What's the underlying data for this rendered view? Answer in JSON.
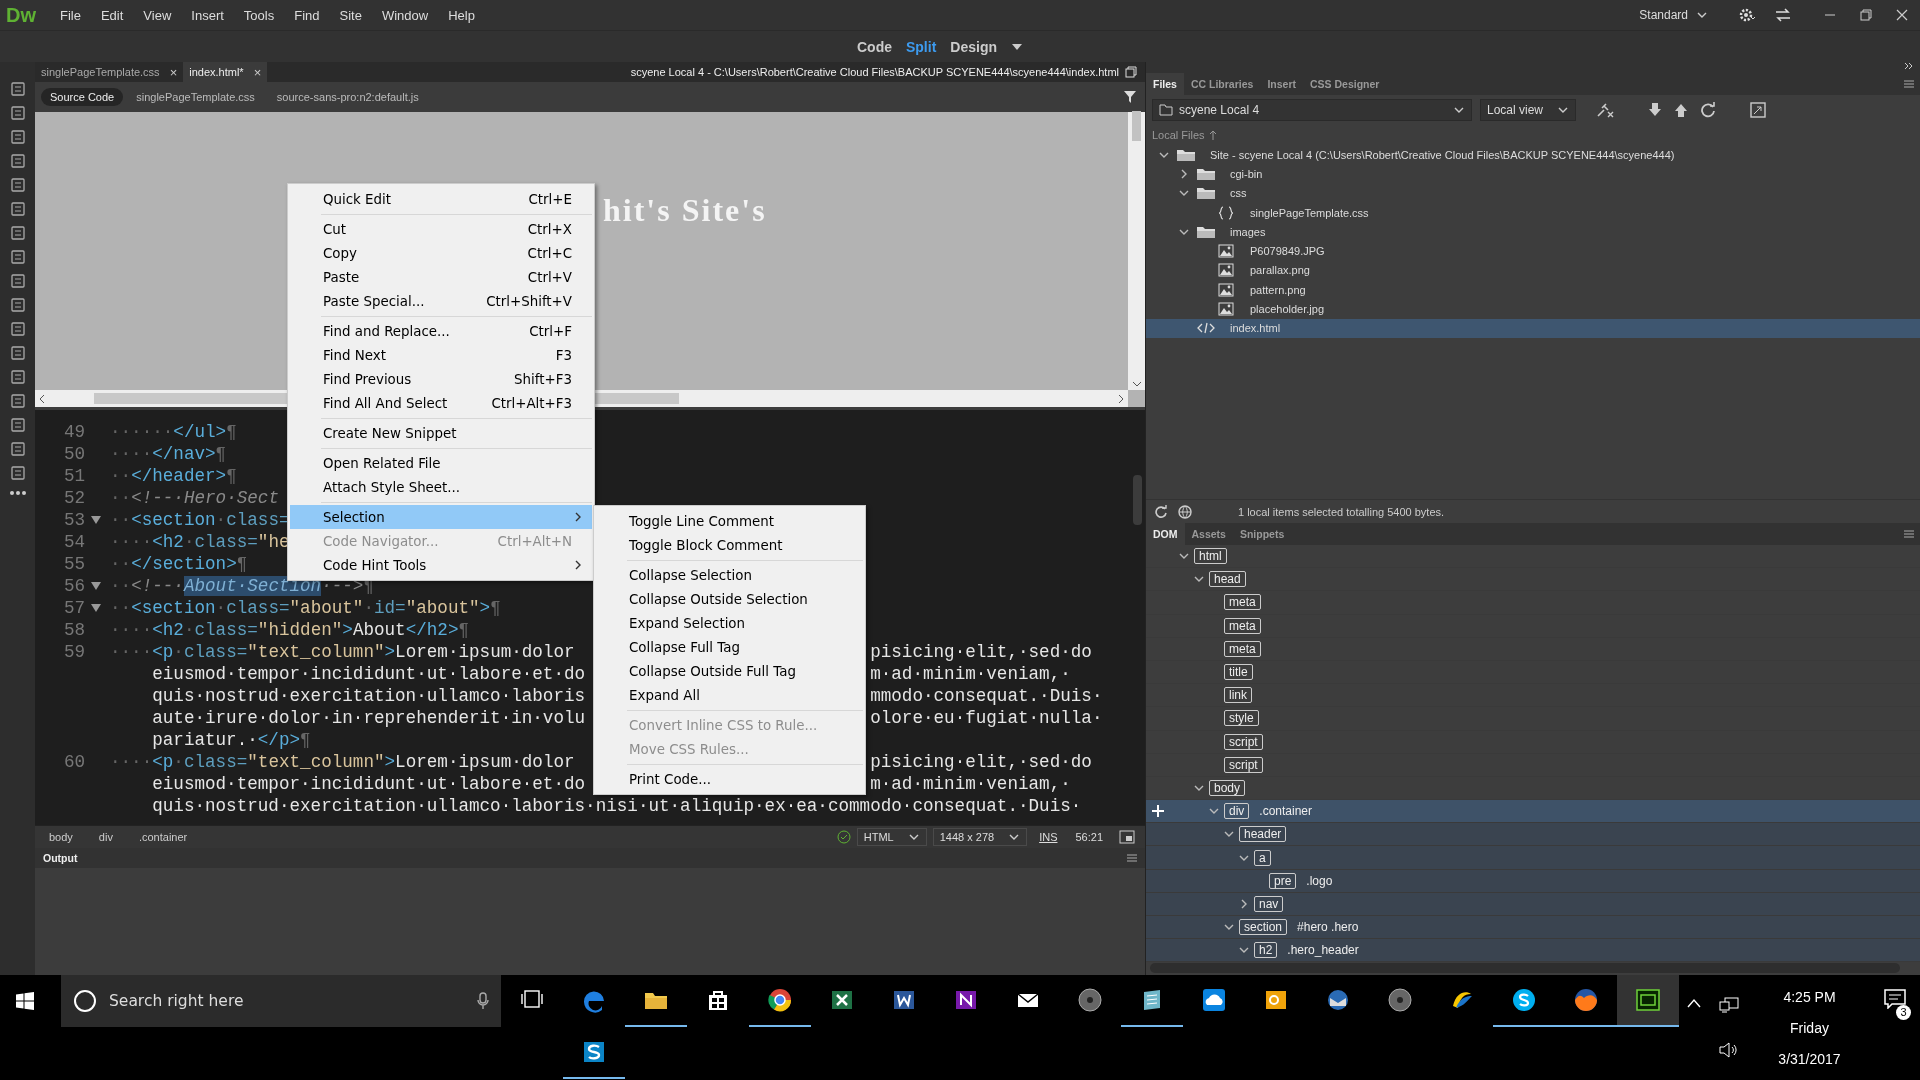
{
  "app": {
    "logo": "Dw",
    "menu": [
      "File",
      "Edit",
      "View",
      "Insert",
      "Tools",
      "Find",
      "Site",
      "Window",
      "Help"
    ],
    "workspace": "Standard"
  },
  "view_switch": [
    {
      "label": "Code",
      "selected": false
    },
    {
      "label": "Split",
      "selected": true
    },
    {
      "label": "Design",
      "selected": false
    }
  ],
  "document_tabs": [
    {
      "label": "singlePageTemplate.css",
      "close": "×",
      "selected": false
    },
    {
      "label": "index.html*",
      "close": "×",
      "selected": true
    }
  ],
  "document_path": "scyene Local 4 - C:\\Users\\Robert\\Creative Cloud Files\\BACKUP SCYENE444\\scyene444\\index.html",
  "related_files": [
    {
      "label": "Source Code",
      "selected": true
    },
    {
      "label": "singlePageTemplate.css",
      "selected": false
    },
    {
      "label": "source-sans-pro:n2:default.js",
      "selected": false
    }
  ],
  "design_view": {
    "heading": "hit's Site's"
  },
  "code_lines": [
    {
      "number": "49",
      "fold": false,
      "left": [
        {
          "kind": "ws",
          "text": "······"
        },
        {
          "kind": "tag",
          "text": "</ul>"
        },
        {
          "kind": "ws",
          "text": "¶"
        }
      ]
    },
    {
      "number": "50",
      "fold": false,
      "left": [
        {
          "kind": "ws",
          "text": "····"
        },
        {
          "kind": "tag",
          "text": "</nav>"
        },
        {
          "kind": "ws",
          "text": "¶"
        }
      ]
    },
    {
      "number": "51",
      "fold": false,
      "left": [
        {
          "kind": "ws",
          "text": "··"
        },
        {
          "kind": "tag",
          "text": "</header>"
        },
        {
          "kind": "ws",
          "text": "¶"
        }
      ]
    },
    {
      "number": "52",
      "fold": false,
      "left": [
        {
          "kind": "ws",
          "text": "··"
        },
        {
          "kind": "cmt",
          "text": "<!--·Hero·Sect"
        }
      ]
    },
    {
      "number": "53",
      "fold": true,
      "left": [
        {
          "kind": "ws",
          "text": "··"
        },
        {
          "kind": "tag",
          "text": "<section"
        },
        {
          "kind": "ws",
          "text": "·"
        },
        {
          "kind": "attr",
          "text": "class="
        }
      ]
    },
    {
      "number": "54",
      "fold": false,
      "left": [
        {
          "kind": "ws",
          "text": "····"
        },
        {
          "kind": "tag",
          "text": "<h2"
        },
        {
          "kind": "ws",
          "text": "·"
        },
        {
          "kind": "attr",
          "text": "class="
        },
        {
          "kind": "str",
          "text": "\"he"
        }
      ]
    },
    {
      "number": "55",
      "fold": false,
      "left": [
        {
          "kind": "ws",
          "text": "··"
        },
        {
          "kind": "tag",
          "text": "</section>"
        },
        {
          "kind": "ws",
          "text": "¶"
        }
      ]
    },
    {
      "number": "56",
      "fold": true,
      "left": [
        {
          "kind": "ws",
          "text": "··"
        },
        {
          "kind": "cmt",
          "text": "<!--·"
        },
        {
          "kind": "sel",
          "text": "About·Section"
        },
        {
          "kind": "cmt",
          "text": "·-->"
        },
        {
          "kind": "ws",
          "text": "¶"
        }
      ]
    },
    {
      "number": "57",
      "fold": true,
      "left": [
        {
          "kind": "ws",
          "text": "··"
        },
        {
          "kind": "tag",
          "text": "<section"
        },
        {
          "kind": "ws",
          "text": "·"
        },
        {
          "kind": "attr",
          "text": "class="
        },
        {
          "kind": "str",
          "text": "\"about\""
        },
        {
          "kind": "ws",
          "text": "·"
        },
        {
          "kind": "attr",
          "text": "id="
        },
        {
          "kind": "str",
          "text": "\"about\""
        },
        {
          "kind": "tag",
          "text": ">"
        },
        {
          "kind": "ws",
          "text": "¶"
        }
      ]
    },
    {
      "number": "58",
      "fold": false,
      "left": [
        {
          "kind": "ws",
          "text": "····"
        },
        {
          "kind": "tag",
          "text": "<h2"
        },
        {
          "kind": "ws",
          "text": "·"
        },
        {
          "kind": "attr",
          "text": "class="
        },
        {
          "kind": "str",
          "text": "\"hidden\""
        },
        {
          "kind": "tag",
          "text": ">"
        },
        {
          "kind": "txt",
          "text": "About"
        },
        {
          "kind": "tag",
          "text": "</h2>"
        },
        {
          "kind": "ws",
          "text": "¶"
        }
      ]
    },
    {
      "number": "59",
      "fold": false,
      "left": [
        {
          "kind": "ws",
          "text": "····"
        },
        {
          "kind": "tag",
          "text": "<p"
        },
        {
          "kind": "ws",
          "text": "·"
        },
        {
          "kind": "attr",
          "text": "class="
        },
        {
          "kind": "str",
          "text": "\"text_column\""
        },
        {
          "kind": "tag",
          "text": ">"
        },
        {
          "kind": "txt",
          "text": "Lorem·ipsum·dolor"
        }
      ],
      "right": [
        {
          "kind": "txt",
          "text": "pisicing·elit,·sed·do"
        }
      ]
    },
    {
      "fold": false,
      "left": [
        {
          "kind": "txt",
          "text": "eiusmod·tempor·incididunt·ut·labore·et·do"
        }
      ],
      "right": [
        {
          "kind": "txt",
          "text": "m·ad·minim·veniam,·"
        }
      ]
    },
    {
      "fold": false,
      "left": [
        {
          "kind": "txt",
          "text": "quis·nostrud·exercitation·ullamco·laboris"
        }
      ],
      "right": [
        {
          "kind": "txt",
          "text": "mmodo·consequat.·Duis·"
        }
      ]
    },
    {
      "fold": false,
      "left": [
        {
          "kind": "txt",
          "text": "aute·irure·dolor·in·reprehenderit·in·volu"
        }
      ],
      "right": [
        {
          "kind": "txt",
          "text": "olore·eu·fugiat·nulla·"
        }
      ]
    },
    {
      "fold": false,
      "left": [
        {
          "kind": "txt",
          "text": "pariatur.·"
        },
        {
          "kind": "tag",
          "text": "</p>"
        },
        {
          "kind": "ws",
          "text": "¶"
        }
      ]
    },
    {
      "number": "60",
      "fold": false,
      "left": [
        {
          "kind": "ws",
          "text": "····"
        },
        {
          "kind": "tag",
          "text": "<p"
        },
        {
          "kind": "ws",
          "text": "·"
        },
        {
          "kind": "attr",
          "text": "class="
        },
        {
          "kind": "str",
          "text": "\"text_column\""
        },
        {
          "kind": "tag",
          "text": ">"
        },
        {
          "kind": "txt",
          "text": "Lorem·ipsum·dolor"
        }
      ],
      "right": [
        {
          "kind": "txt",
          "text": "pisicing·elit,·sed·do"
        }
      ]
    },
    {
      "fold": false,
      "left": [
        {
          "kind": "txt",
          "text": "eiusmod·tempor·incididunt·ut·labore·et·do"
        }
      ],
      "right": [
        {
          "kind": "txt",
          "text": "m·ad·minim·veniam,·"
        }
      ]
    },
    {
      "fold": false,
      "left": [
        {
          "kind": "txt",
          "text": "quis·nostrud·exercitation·ullamco·laboris·nisi·ut·aliquip·ex·ea·commodo·consequat.·Duis·"
        }
      ]
    }
  ],
  "status_bar": {
    "breadcrumb": [
      "body",
      "div",
      ".container"
    ],
    "language": "HTML",
    "size": "1448 x 278",
    "mode": "INS",
    "position": "56:21"
  },
  "output_panel": {
    "tab": "Output"
  },
  "context_menu": [
    {
      "kind": "item",
      "label": "Quick Edit",
      "shortcut": "Ctrl+E",
      "disabled": false,
      "submenu": false,
      "selected": false
    },
    {
      "kind": "separator"
    },
    {
      "kind": "item",
      "label": "Cut",
      "shortcut": "Ctrl+X",
      "disabled": false,
      "submenu": false,
      "selected": false
    },
    {
      "kind": "item",
      "label": "Copy",
      "shortcut": "Ctrl+C",
      "disabled": false,
      "submenu": false,
      "selected": false
    },
    {
      "kind": "item",
      "label": "Paste",
      "shortcut": "Ctrl+V",
      "disabled": false,
      "submenu": false,
      "selected": false
    },
    {
      "kind": "item",
      "label": "Paste Special...",
      "shortcut": "Ctrl+Shift+V",
      "disabled": false,
      "submenu": false,
      "selected": false
    },
    {
      "kind": "separator"
    },
    {
      "kind": "item",
      "label": "Find and Replace...",
      "shortcut": "Ctrl+F",
      "disabled": false,
      "submenu": false,
      "selected": false
    },
    {
      "kind": "item",
      "label": "Find Next",
      "shortcut": "F3",
      "disabled": false,
      "submenu": false,
      "selected": false
    },
    {
      "kind": "item",
      "label": "Find Previous",
      "shortcut": "Shift+F3",
      "disabled": false,
      "submenu": false,
      "selected": false
    },
    {
      "kind": "item",
      "label": "Find All And Select",
      "shortcut": "Ctrl+Alt+F3",
      "disabled": false,
      "submenu": false,
      "selected": false
    },
    {
      "kind": "separator"
    },
    {
      "kind": "item",
      "label": "Create New Snippet",
      "disabled": false,
      "submenu": false,
      "selected": false
    },
    {
      "kind": "separator"
    },
    {
      "kind": "item",
      "label": "Open Related File",
      "disabled": false,
      "submenu": false,
      "selected": false
    },
    {
      "kind": "item",
      "label": "Attach Style Sheet...",
      "disabled": false,
      "submenu": false,
      "selected": false
    },
    {
      "kind": "separator"
    },
    {
      "kind": "item",
      "label": "Selection",
      "disabled": false,
      "submenu": true,
      "selected": true
    },
    {
      "kind": "item",
      "label": "Code Navigator...",
      "shortcut": "Ctrl+Alt+N",
      "disabled": true,
      "submenu": false,
      "selected": false
    },
    {
      "kind": "item",
      "label": "Code Hint Tools",
      "disabled": false,
      "submenu": true,
      "selected": false
    }
  ],
  "submenu": [
    {
      "kind": "item",
      "label": "Toggle Line Comment",
      "disabled": false,
      "selected": false
    },
    {
      "kind": "item",
      "label": "Toggle Block Comment",
      "disabled": false,
      "selected": false
    },
    {
      "kind": "separator"
    },
    {
      "kind": "item",
      "label": "Collapse Selection",
      "disabled": false,
      "selected": false
    },
    {
      "kind": "item",
      "label": "Collapse Outside Selection",
      "disabled": false,
      "selected": false
    },
    {
      "kind": "item",
      "label": "Expand Selection",
      "disabled": false,
      "selected": false
    },
    {
      "kind": "item",
      "label": "Collapse Full Tag",
      "disabled": false,
      "selected": false
    },
    {
      "kind": "item",
      "label": "Collapse Outside Full Tag",
      "disabled": false,
      "selected": false
    },
    {
      "kind": "item",
      "label": "Expand All",
      "disabled": false,
      "selected": false
    },
    {
      "kind": "separator"
    },
    {
      "kind": "item",
      "label": "Convert Inline CSS to Rule...",
      "disabled": true,
      "selected": false
    },
    {
      "kind": "item",
      "label": "Move CSS Rules...",
      "disabled": true,
      "selected": false
    },
    {
      "kind": "separator"
    },
    {
      "kind": "item",
      "label": "Print Code...",
      "disabled": false,
      "selected": false
    }
  ],
  "files_panel": {
    "tabs": [
      {
        "label": "Files",
        "selected": true
      },
      {
        "label": "CC Libraries",
        "selected": false
      },
      {
        "label": "Insert",
        "selected": false
      },
      {
        "label": "CSS Designer",
        "selected": false
      }
    ],
    "site": "scyene Local 4",
    "view": "Local view",
    "header": "Local Files",
    "tree": [
      {
        "kind": "folder",
        "name": "Site - scyene Local 4 (C:\\Users\\Robert\\Creative Cloud Files\\BACKUP SCYENE444\\scyene444)",
        "expanded": true,
        "selected": false,
        "children": [
          {
            "kind": "folder",
            "name": "cgi-bin",
            "expanded": false,
            "selected": false
          },
          {
            "kind": "folder",
            "name": "css",
            "expanded": true,
            "selected": false,
            "children": [
              {
                "kind": "css",
                "name": "singlePageTemplate.css",
                "selected": false
              }
            ]
          },
          {
            "kind": "folder",
            "name": "images",
            "expanded": true,
            "selected": false,
            "children": [
              {
                "kind": "image",
                "name": "P6079849.JPG",
                "selected": false
              },
              {
                "kind": "image",
                "name": "parallax.png",
                "selected": false
              },
              {
                "kind": "image",
                "name": "pattern.png",
                "selected": false
              },
              {
                "kind": "image",
                "name": "placeholder.jpg",
                "selected": false
              }
            ]
          },
          {
            "kind": "html",
            "name": "index.html",
            "selected": true
          }
        ]
      }
    ],
    "status": "1 local items selected totalling 5400 bytes."
  },
  "dom_panel": {
    "tabs": [
      {
        "label": "DOM",
        "selected": true
      },
      {
        "label": "Assets",
        "selected": false
      },
      {
        "label": "Snippets",
        "selected": false
      }
    ],
    "tree": [
      {
        "tag": "html",
        "expanded": true,
        "selected": false,
        "children": [
          {
            "tag": "head",
            "expanded": true,
            "selected": false,
            "children": [
              {
                "tag": "meta",
                "selected": false
              },
              {
                "tag": "meta",
                "selected": false
              },
              {
                "tag": "meta",
                "selected": false
              },
              {
                "tag": "title",
                "selected": false
              },
              {
                "tag": "link",
                "selected": false
              },
              {
                "tag": "style",
                "selected": false
              },
              {
                "tag": "script",
                "selected": false
              },
              {
                "tag": "script",
                "selected": false
              }
            ]
          },
          {
            "tag": "body",
            "expanded": true,
            "selected": false,
            "children": [
              {
                "tag": "div",
                "label": ".container",
                "expanded": true,
                "selected": true,
                "children": [
                  {
                    "tag": "header",
                    "expanded": true,
                    "selected": false,
                    "children": [
                      {
                        "tag": "a",
                        "expanded": true,
                        "selected": false,
                        "children": [
                          {
                            "tag": "pre",
                            "label": ".logo",
                            "selected": false
                          }
                        ]
                      },
                      {
                        "tag": "nav",
                        "expanded": false,
                        "selected": false
                      }
                    ]
                  },
                  {
                    "tag": "section",
                    "label": "#hero .hero",
                    "expanded": true,
                    "selected": false,
                    "children": [
                      {
                        "tag": "h2",
                        "label": ".hero_header",
                        "expanded": true,
                        "selected": false
                      }
                    ]
                  }
                ]
              }
            ]
          }
        ]
      }
    ]
  },
  "taskbar": {
    "search_placeholder": "Search right here",
    "apps": [
      {
        "kind": "edge",
        "running": false,
        "selected": false
      },
      {
        "kind": "explorer",
        "running": true,
        "selected": false
      },
      {
        "kind": "store",
        "running": false,
        "selected": false
      },
      {
        "kind": "chrome",
        "running": true,
        "selected": false
      },
      {
        "kind": "excel",
        "running": false,
        "selected": false
      },
      {
        "kind": "word",
        "running": false,
        "selected": false
      },
      {
        "kind": "onenote",
        "running": false,
        "selected": false
      },
      {
        "kind": "mail",
        "running": false,
        "selected": false
      },
      {
        "kind": "disc",
        "running": false,
        "selected": false
      },
      {
        "kind": "notes",
        "running": true,
        "selected": false
      },
      {
        "kind": "onedrive",
        "running": false,
        "selected": false
      },
      {
        "kind": "outlook",
        "running": false,
        "selected": false
      },
      {
        "kind": "thunderbird",
        "running": false,
        "selected": false
      },
      {
        "kind": "disc",
        "running": false,
        "selected": false
      },
      {
        "kind": "swirl",
        "running": false,
        "selected": false
      },
      {
        "kind": "skype",
        "running": true,
        "selected": false
      },
      {
        "kind": "firefox",
        "running": true,
        "selected": false
      },
      {
        "kind": "dreamweaver",
        "running": true,
        "selected": true
      },
      {
        "kind": "sketch",
        "running": true,
        "selected": false
      }
    ],
    "time": "4:25 PM",
    "day": "Friday",
    "date": "3/31/2017",
    "notifications": "3"
  }
}
